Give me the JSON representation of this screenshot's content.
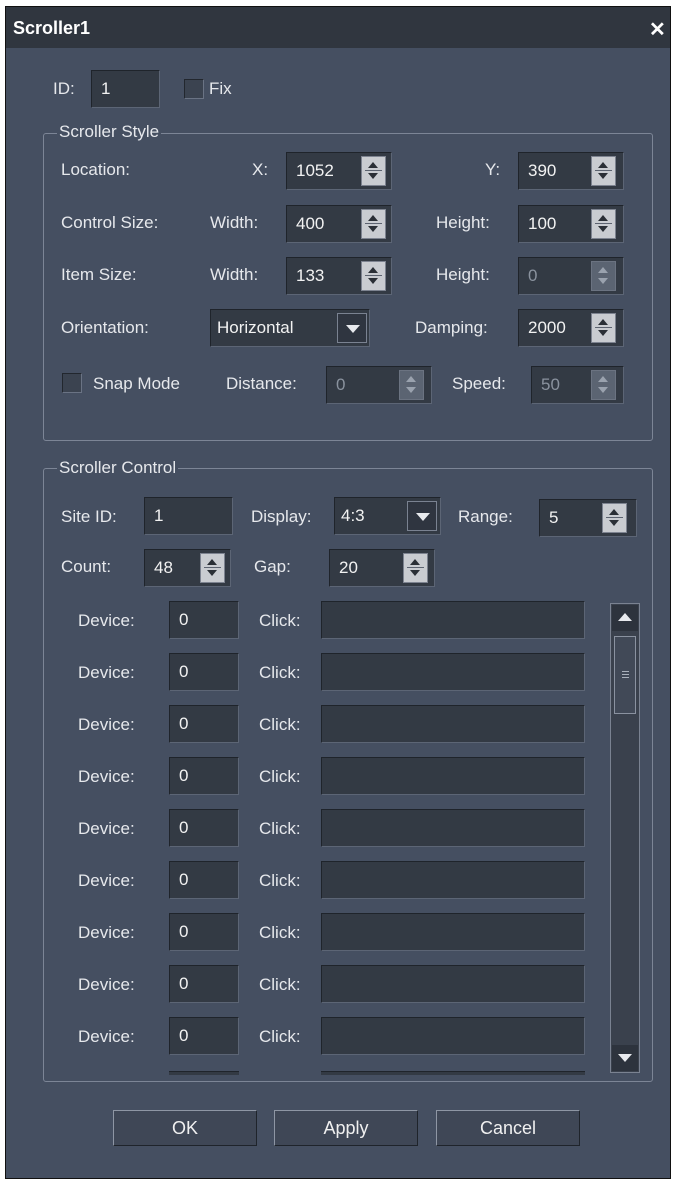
{
  "window": {
    "title": "Scroller1",
    "close_glyph": "✕"
  },
  "top": {
    "id_label": "ID:",
    "id_value": "1",
    "fix_label": "Fix"
  },
  "style": {
    "group_label": "Scroller Style",
    "location_label": "Location:",
    "x_label": "X:",
    "x_value": "1052",
    "y_label": "Y:",
    "y_value": "390",
    "control_size_label": "Control Size:",
    "cs_width_label": "Width:",
    "cs_width_value": "400",
    "cs_height_label": "Height:",
    "cs_height_value": "100",
    "item_size_label": "Item Size:",
    "is_width_label": "Width:",
    "is_width_value": "133",
    "is_height_label": "Height:",
    "is_height_value": "0",
    "orientation_label": "Orientation:",
    "orientation_value": "Horizontal",
    "damping_label": "Damping:",
    "damping_value": "2000",
    "snap_label": "Snap Mode",
    "distance_label": "Distance:",
    "distance_value": "0",
    "speed_label": "Speed:",
    "speed_value": "50"
  },
  "control": {
    "group_label": "Scroller Control",
    "site_id_label": "Site ID:",
    "site_id_value": "1",
    "display_label": "Display:",
    "display_value": "4:3",
    "range_label": "Range:",
    "range_value": "5",
    "count_label": "Count:",
    "count_value": "48",
    "gap_label": "Gap:",
    "gap_value": "20",
    "rows": [
      {
        "device_label": "Device:",
        "device_value": "0",
        "click_label": "Click:",
        "click_value": ""
      },
      {
        "device_label": "Device:",
        "device_value": "0",
        "click_label": "Click:",
        "click_value": ""
      },
      {
        "device_label": "Device:",
        "device_value": "0",
        "click_label": "Click:",
        "click_value": ""
      },
      {
        "device_label": "Device:",
        "device_value": "0",
        "click_label": "Click:",
        "click_value": ""
      },
      {
        "device_label": "Device:",
        "device_value": "0",
        "click_label": "Click:",
        "click_value": ""
      },
      {
        "device_label": "Device:",
        "device_value": "0",
        "click_label": "Click:",
        "click_value": ""
      },
      {
        "device_label": "Device:",
        "device_value": "0",
        "click_label": "Click:",
        "click_value": ""
      },
      {
        "device_label": "Device:",
        "device_value": "0",
        "click_label": "Click:",
        "click_value": ""
      },
      {
        "device_label": "Device:",
        "device_value": "0",
        "click_label": "Click:",
        "click_value": ""
      }
    ]
  },
  "buttons": {
    "ok": "OK",
    "apply": "Apply",
    "cancel": "Cancel"
  }
}
